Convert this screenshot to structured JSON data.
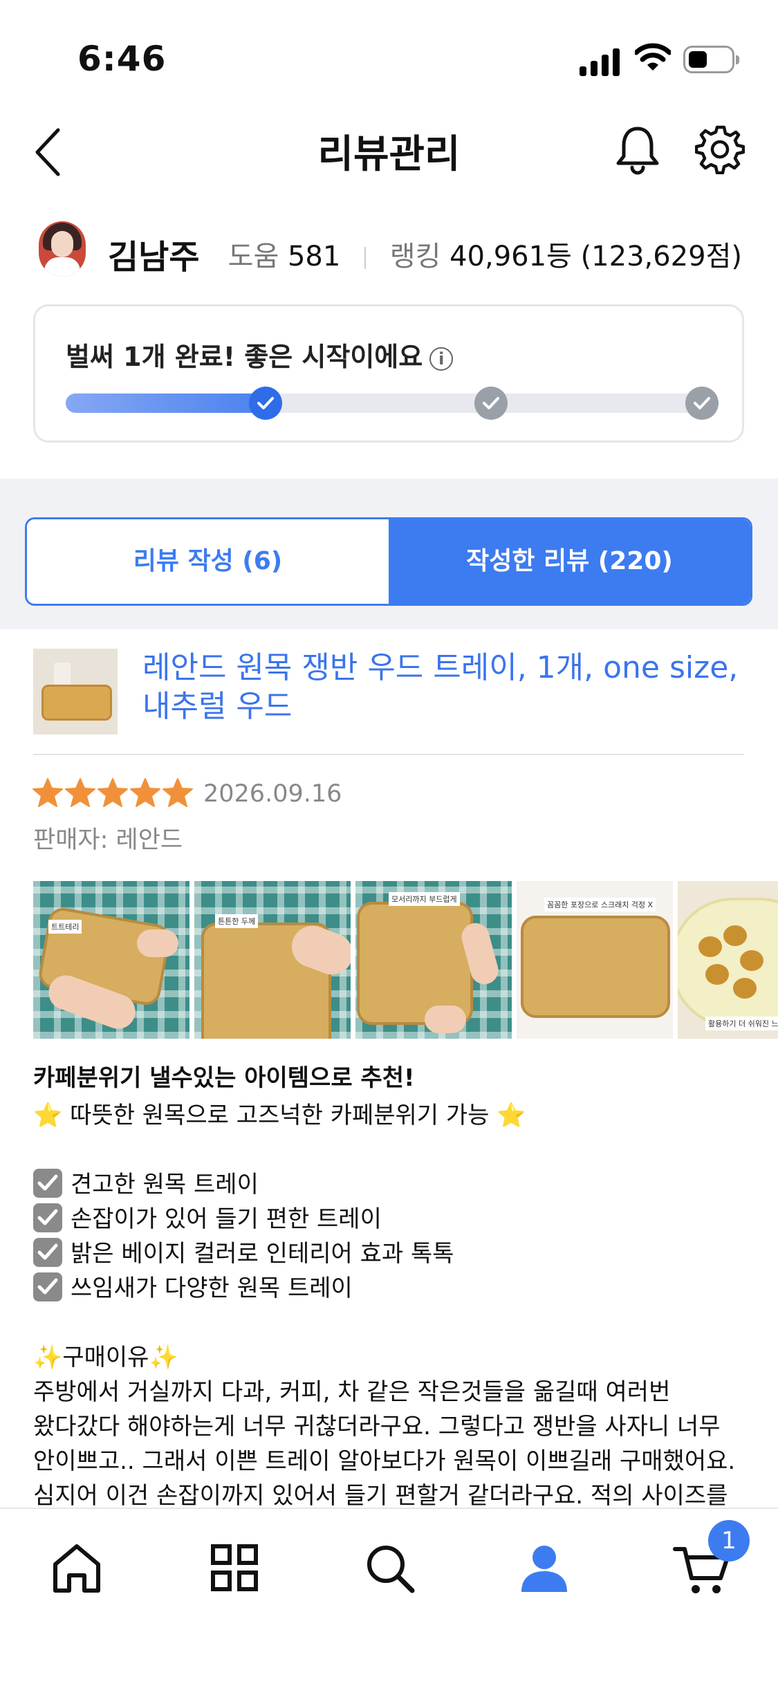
{
  "status_bar": {
    "time": "6:46"
  },
  "header": {
    "title": "리뷰관리"
  },
  "profile": {
    "name": "김남주",
    "help_label": "도움",
    "help_value": "581",
    "ranking_label": "랭킹",
    "ranking_value": "40,961등 (123,629점)"
  },
  "progress": {
    "message": "벌써 1개 완료! 좋은 시작이에요",
    "fill_fraction": 0.31,
    "milestones_completed": 1,
    "milestones_total": 3
  },
  "tabs": [
    {
      "label": "리뷰 작성 (6)",
      "selected": false
    },
    {
      "label": "작성한 리뷰 (220)",
      "selected": true
    }
  ],
  "product": {
    "title": "레안드 원목 쟁반 우드 트레이, 1개, one size, 내추럴 우드"
  },
  "review": {
    "rating": 5,
    "date": "2026.09.16",
    "seller": "판매자: 레안드",
    "headline": "카페분위기 낼수있는 아이템으로 추천!",
    "subline": "따뜻한 원목으로 고즈넉한 카페분위기 가능",
    "checklist": [
      "견고한 원목 트레이",
      "손잡이가 있어 들기 편한 트레이",
      "밝은 베이지 컬러로 인테리어 효과 톡톡",
      "쓰임새가 다양한 원목 트레이"
    ],
    "reason_title": "구매이유",
    "reason_body": "주방에서 거실까지 다과, 커피, 차 같은 작은것들을 옮길때 여러번 왔다갔다 해야하는게 너무 귀찮더라구요. 그렇다고 쟁반을 사자니 너무 안이쁘고.. 그래서 이쁜 트레이 알아보다가 원목이 이쁘길래 구매했어요. 심지어 이건 손잡이까지 있어서 들기 편할거 같더라구요. 적의 사이즈를 딱 맞춰 제"
  },
  "photos": [
    {
      "note": "트트테리"
    },
    {
      "note": "튼튼한 두께"
    },
    {
      "note": "모서리까지 부드럽게"
    },
    {
      "note": "꼼꼼한 포장으로 스크래치 걱정 X"
    },
    {
      "note": "활용하기 더 쉬워진 느낌"
    }
  ],
  "tabbar": {
    "items": [
      "home-icon",
      "grid-icon",
      "search-icon",
      "profile-icon",
      "cart-icon"
    ],
    "active": "profile-icon",
    "cart_badge": "1"
  },
  "colors": {
    "accent": "#3d7cf0",
    "star": "#f0913a",
    "muted": "#888888"
  }
}
